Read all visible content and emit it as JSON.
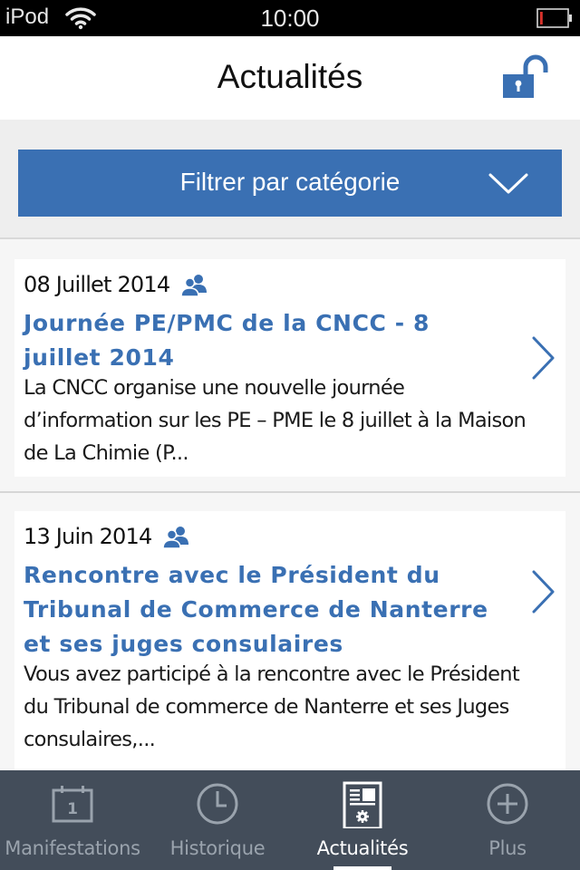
{
  "status_bar": {
    "carrier": "iPod",
    "time": "10:00",
    "battery_level": 0.1,
    "icons": [
      "wifi-icon",
      "battery-icon"
    ]
  },
  "nav": {
    "title": "Actualités",
    "right_icon": "unlocked-padlock-icon"
  },
  "filter": {
    "label": "Filtrer par catégorie",
    "icon": "chevron-down-icon"
  },
  "colors": {
    "accent": "#3a70b3",
    "tab_bar": "#434d5a",
    "tab_inactive": "#9aa3ad",
    "tab_active": "#ffffff",
    "background": "#f6f6f6",
    "filter_area": "#eeeeee"
  },
  "news": [
    {
      "date": "08 Juillet 2014",
      "icon": "people-icon",
      "title": "Journée PE/PMC de la CNCC - 8 juillet 2014",
      "description": "La CNCC organise une nouvelle journée d’information sur les PE – PME le 8 juillet à la Maison de La Chimie (P..."
    },
    {
      "date": "13 Juin 2014",
      "icon": "people-icon",
      "title": "Rencontre avec le Président du Tribunal de Commerce de Nanterre et ses juges consulaires",
      "description": "Vous avez participé à la rencontre avec le Président du Tribunal de commerce de Nanterre et ses Juges consulaires,..."
    }
  ],
  "tabs": [
    {
      "label": "Manifestations",
      "icon": "calendar-icon",
      "icon_text": "1",
      "active": false
    },
    {
      "label": "Historique",
      "icon": "clock-icon",
      "active": false
    },
    {
      "label": "Actualités",
      "icon": "news-document-icon",
      "active": true
    },
    {
      "label": "Plus",
      "icon": "plus-circle-icon",
      "active": false
    }
  ]
}
